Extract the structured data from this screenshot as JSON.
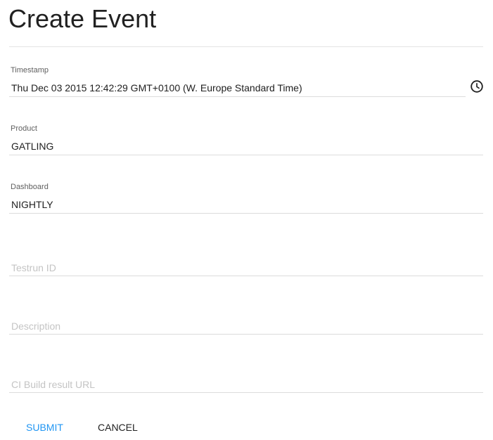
{
  "page": {
    "title": "Create Event"
  },
  "form": {
    "timestamp": {
      "label": "Timestamp",
      "value": "Thu Dec 03 2015 12:42:29 GMT+0100 (W. Europe Standard Time)",
      "icon": "clock-icon"
    },
    "product": {
      "label": "Product",
      "value": "GATLING"
    },
    "dashboard": {
      "label": "Dashboard",
      "value": "NIGHTLY"
    },
    "testrun_id": {
      "placeholder": "Testrun ID"
    },
    "description": {
      "placeholder": "Description"
    },
    "ci_build_url": {
      "placeholder": "CI Build result URL"
    }
  },
  "actions": {
    "submit_label": "SUBMIT",
    "cancel_label": "CANCEL"
  },
  "colors": {
    "accent": "#2196f3",
    "text": "#212121",
    "placeholder": "#c4c4c4",
    "divider": "#dcdcdc"
  }
}
